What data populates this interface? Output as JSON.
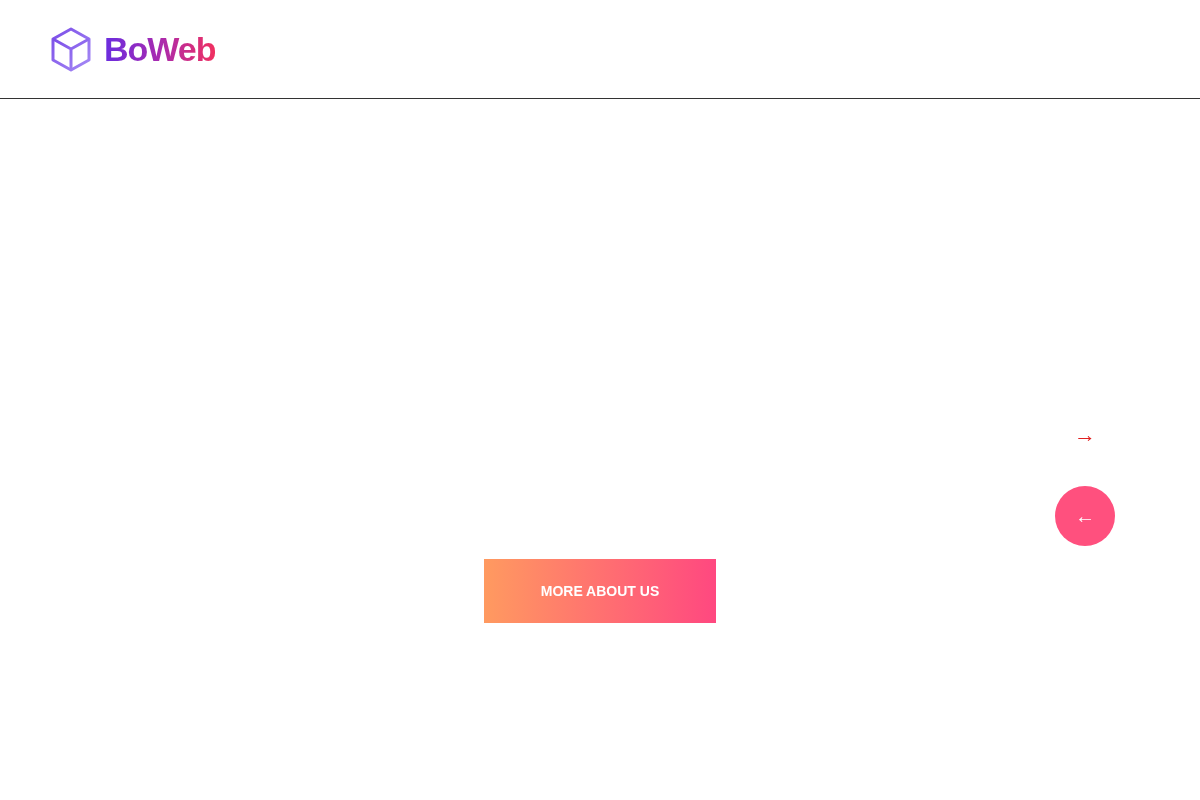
{
  "header": {
    "logo": "BoWeb"
  },
  "slider": {
    "next_label": "→",
    "prev_label": "←"
  },
  "cta": {
    "label": "MORE ABOUT US"
  }
}
